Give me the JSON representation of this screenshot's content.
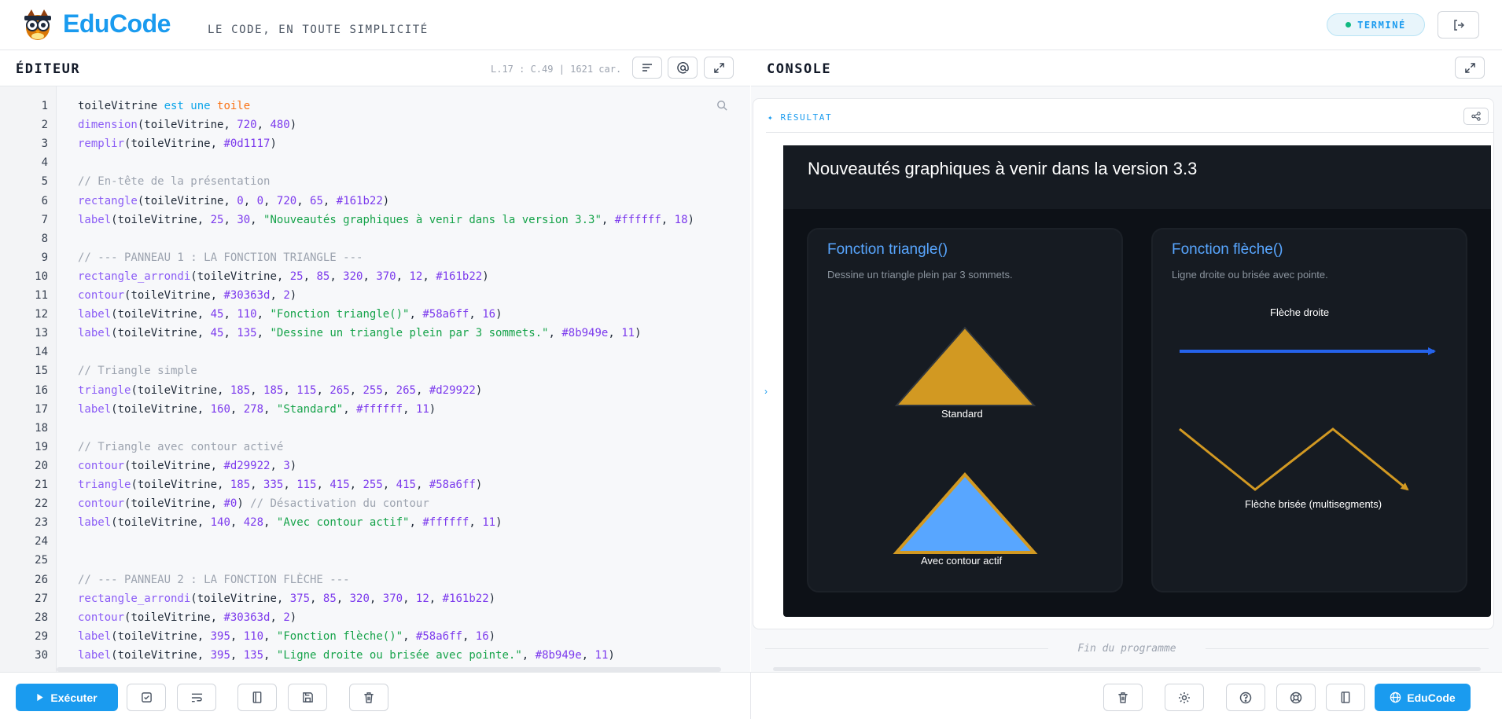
{
  "header": {
    "brand": "EduCode",
    "tagline": "LE CODE, EN TOUTE SIMPLICITÉ",
    "status": "TERMINÉ",
    "logout_icon": "logout-icon"
  },
  "editor": {
    "title": "ÉDITEUR",
    "cursor_info": "L.17 : C.49 | 1621 car.",
    "buttons": [
      "format-icon",
      "at-icon",
      "expand-icon"
    ],
    "lines": [
      {
        "n": "1",
        "tokens": [
          [
            "toileVitrine ",
            ""
          ],
          [
            "est une ",
            "kw"
          ],
          [
            "toile",
            "type"
          ]
        ]
      },
      {
        "n": "2",
        "tokens": [
          [
            "dimension",
            "fn"
          ],
          [
            "(toileVitrine, ",
            ""
          ],
          [
            "720",
            "num"
          ],
          [
            ", ",
            ""
          ],
          [
            "480",
            "num"
          ],
          [
            ")",
            ""
          ]
        ]
      },
      {
        "n": "3",
        "tokens": [
          [
            "remplir",
            "fn"
          ],
          [
            "(toileVitrine, ",
            ""
          ],
          [
            "#0d1117",
            "hex"
          ],
          [
            ")",
            ""
          ]
        ]
      },
      {
        "n": "4",
        "tokens": []
      },
      {
        "n": "5",
        "tokens": [
          [
            "// En-tête de la présentation",
            "com"
          ]
        ]
      },
      {
        "n": "6",
        "tokens": [
          [
            "rectangle",
            "fn"
          ],
          [
            "(toileVitrine, ",
            ""
          ],
          [
            "0",
            "num"
          ],
          [
            ", ",
            ""
          ],
          [
            "0",
            "num"
          ],
          [
            ", ",
            ""
          ],
          [
            "720",
            "num"
          ],
          [
            ", ",
            ""
          ],
          [
            "65",
            "num"
          ],
          [
            ", ",
            ""
          ],
          [
            "#161b22",
            "hex"
          ],
          [
            ")",
            ""
          ]
        ]
      },
      {
        "n": "7",
        "tokens": [
          [
            "label",
            "fn"
          ],
          [
            "(toileVitrine, ",
            ""
          ],
          [
            "25",
            "num"
          ],
          [
            ", ",
            ""
          ],
          [
            "30",
            "num"
          ],
          [
            ", ",
            ""
          ],
          [
            "\"Nouveautés graphiques à venir dans la version 3.3\"",
            "str"
          ],
          [
            ", ",
            ""
          ],
          [
            "#ffffff",
            "hex"
          ],
          [
            ", ",
            ""
          ],
          [
            "18",
            "num"
          ],
          [
            ")",
            ""
          ]
        ]
      },
      {
        "n": "8",
        "tokens": []
      },
      {
        "n": "9",
        "tokens": [
          [
            "// --- PANNEAU 1 : LA FONCTION TRIANGLE ---",
            "com"
          ]
        ]
      },
      {
        "n": "10",
        "tokens": [
          [
            "rectangle_arrondi",
            "fn"
          ],
          [
            "(toileVitrine, ",
            ""
          ],
          [
            "25",
            "num"
          ],
          [
            ", ",
            ""
          ],
          [
            "85",
            "num"
          ],
          [
            ", ",
            ""
          ],
          [
            "320",
            "num"
          ],
          [
            ", ",
            ""
          ],
          [
            "370",
            "num"
          ],
          [
            ", ",
            ""
          ],
          [
            "12",
            "num"
          ],
          [
            ", ",
            ""
          ],
          [
            "#161b22",
            "hex"
          ],
          [
            ")",
            ""
          ]
        ]
      },
      {
        "n": "11",
        "tokens": [
          [
            "contour",
            "fn"
          ],
          [
            "(toileVitrine, ",
            ""
          ],
          [
            "#30363d",
            "hex"
          ],
          [
            ", ",
            ""
          ],
          [
            "2",
            "num"
          ],
          [
            ")",
            ""
          ]
        ]
      },
      {
        "n": "12",
        "tokens": [
          [
            "label",
            "fn"
          ],
          [
            "(toileVitrine, ",
            ""
          ],
          [
            "45",
            "num"
          ],
          [
            ", ",
            ""
          ],
          [
            "110",
            "num"
          ],
          [
            ", ",
            ""
          ],
          [
            "\"Fonction triangle()\"",
            "str"
          ],
          [
            ", ",
            ""
          ],
          [
            "#58a6ff",
            "hex"
          ],
          [
            ", ",
            ""
          ],
          [
            "16",
            "num"
          ],
          [
            ")",
            ""
          ]
        ]
      },
      {
        "n": "13",
        "tokens": [
          [
            "label",
            "fn"
          ],
          [
            "(toileVitrine, ",
            ""
          ],
          [
            "45",
            "num"
          ],
          [
            ", ",
            ""
          ],
          [
            "135",
            "num"
          ],
          [
            ", ",
            ""
          ],
          [
            "\"Dessine un triangle plein par 3 sommets.\"",
            "str"
          ],
          [
            ", ",
            ""
          ],
          [
            "#8b949e",
            "hex"
          ],
          [
            ", ",
            ""
          ],
          [
            "11",
            "num"
          ],
          [
            ")",
            ""
          ]
        ]
      },
      {
        "n": "14",
        "tokens": []
      },
      {
        "n": "15",
        "tokens": [
          [
            "// Triangle simple",
            "com"
          ]
        ]
      },
      {
        "n": "16",
        "tokens": [
          [
            "triangle",
            "fn"
          ],
          [
            "(toileVitrine, ",
            ""
          ],
          [
            "185",
            "num"
          ],
          [
            ", ",
            ""
          ],
          [
            "185",
            "num"
          ],
          [
            ", ",
            ""
          ],
          [
            "115",
            "num"
          ],
          [
            ", ",
            ""
          ],
          [
            "265",
            "num"
          ],
          [
            ", ",
            ""
          ],
          [
            "255",
            "num"
          ],
          [
            ", ",
            ""
          ],
          [
            "265",
            "num"
          ],
          [
            ", ",
            ""
          ],
          [
            "#d29922",
            "hex"
          ],
          [
            ")",
            ""
          ]
        ]
      },
      {
        "n": "17",
        "tokens": [
          [
            "label",
            "fn"
          ],
          [
            "(toileVitrine, ",
            ""
          ],
          [
            "160",
            "num"
          ],
          [
            ", ",
            ""
          ],
          [
            "278",
            "num"
          ],
          [
            ", ",
            ""
          ],
          [
            "\"Standard\"",
            "str"
          ],
          [
            ", ",
            ""
          ],
          [
            "#ffffff",
            "hex"
          ],
          [
            ", ",
            ""
          ],
          [
            "11",
            "num"
          ],
          [
            ")",
            ""
          ]
        ]
      },
      {
        "n": "18",
        "tokens": []
      },
      {
        "n": "19",
        "tokens": [
          [
            "// Triangle avec contour activé",
            "com"
          ]
        ]
      },
      {
        "n": "20",
        "tokens": [
          [
            "contour",
            "fn"
          ],
          [
            "(toileVitrine, ",
            ""
          ],
          [
            "#d29922",
            "hex"
          ],
          [
            ", ",
            ""
          ],
          [
            "3",
            "num"
          ],
          [
            ")",
            ""
          ]
        ]
      },
      {
        "n": "21",
        "tokens": [
          [
            "triangle",
            "fn"
          ],
          [
            "(toileVitrine, ",
            ""
          ],
          [
            "185",
            "num"
          ],
          [
            ", ",
            ""
          ],
          [
            "335",
            "num"
          ],
          [
            ", ",
            ""
          ],
          [
            "115",
            "num"
          ],
          [
            ", ",
            ""
          ],
          [
            "415",
            "num"
          ],
          [
            ", ",
            ""
          ],
          [
            "255",
            "num"
          ],
          [
            ", ",
            ""
          ],
          [
            "415",
            "num"
          ],
          [
            ", ",
            ""
          ],
          [
            "#58a6ff",
            "hex"
          ],
          [
            ")",
            ""
          ]
        ]
      },
      {
        "n": "22",
        "tokens": [
          [
            "contour",
            "fn"
          ],
          [
            "(toileVitrine, ",
            ""
          ],
          [
            "#0",
            "hex"
          ],
          [
            ") ",
            ""
          ],
          [
            "// Désactivation du contour",
            "com"
          ]
        ]
      },
      {
        "n": "23",
        "tokens": [
          [
            "label",
            "fn"
          ],
          [
            "(toileVitrine, ",
            ""
          ],
          [
            "140",
            "num"
          ],
          [
            ", ",
            ""
          ],
          [
            "428",
            "num"
          ],
          [
            ", ",
            ""
          ],
          [
            "\"Avec contour actif\"",
            "str"
          ],
          [
            ", ",
            ""
          ],
          [
            "#ffffff",
            "hex"
          ],
          [
            ", ",
            ""
          ],
          [
            "11",
            "num"
          ],
          [
            ")",
            ""
          ]
        ]
      },
      {
        "n": "24",
        "tokens": []
      },
      {
        "n": "25",
        "tokens": []
      },
      {
        "n": "26",
        "tokens": [
          [
            "// --- PANNEAU 2 : LA FONCTION FLÈCHE ---",
            "com"
          ]
        ]
      },
      {
        "n": "27",
        "tokens": [
          [
            "rectangle_arrondi",
            "fn"
          ],
          [
            "(toileVitrine, ",
            ""
          ],
          [
            "375",
            "num"
          ],
          [
            ", ",
            ""
          ],
          [
            "85",
            "num"
          ],
          [
            ", ",
            ""
          ],
          [
            "320",
            "num"
          ],
          [
            ", ",
            ""
          ],
          [
            "370",
            "num"
          ],
          [
            ", ",
            ""
          ],
          [
            "12",
            "num"
          ],
          [
            ", ",
            ""
          ],
          [
            "#161b22",
            "hex"
          ],
          [
            ")",
            ""
          ]
        ]
      },
      {
        "n": "28",
        "tokens": [
          [
            "contour",
            "fn"
          ],
          [
            "(toileVitrine, ",
            ""
          ],
          [
            "#30363d",
            "hex"
          ],
          [
            ", ",
            ""
          ],
          [
            "2",
            "num"
          ],
          [
            ")",
            ""
          ]
        ]
      },
      {
        "n": "29",
        "tokens": [
          [
            "label",
            "fn"
          ],
          [
            "(toileVitrine, ",
            ""
          ],
          [
            "395",
            "num"
          ],
          [
            ", ",
            ""
          ],
          [
            "110",
            "num"
          ],
          [
            ", ",
            ""
          ],
          [
            "\"Fonction flèche()\"",
            "str"
          ],
          [
            ", ",
            ""
          ],
          [
            "#58a6ff",
            "hex"
          ],
          [
            ", ",
            ""
          ],
          [
            "16",
            "num"
          ],
          [
            ")",
            ""
          ]
        ]
      },
      {
        "n": "30",
        "tokens": [
          [
            "label",
            "fn"
          ],
          [
            "(toileVitrine, ",
            ""
          ],
          [
            "395",
            "num"
          ],
          [
            ", ",
            ""
          ],
          [
            "135",
            "num"
          ],
          [
            ", ",
            ""
          ],
          [
            "\"Ligne droite ou brisée avec pointe.\"",
            "str"
          ],
          [
            ", ",
            ""
          ],
          [
            "#8b949e",
            "hex"
          ],
          [
            ", ",
            ""
          ],
          [
            "11",
            "num"
          ],
          [
            ")",
            ""
          ]
        ]
      }
    ]
  },
  "console": {
    "title": "CONSOLE",
    "result_label": "✦ RÉSULTAT",
    "end_text": "Fin du programme",
    "canvas": {
      "background": "#0d1117",
      "header_text": "Nouveautés graphiques à venir dans la version 3.3",
      "panel1": {
        "title": "Fonction triangle()",
        "desc": "Dessine un triangle plein par 3 sommets.",
        "label_standard": "Standard",
        "label_contour": "Avec contour actif"
      },
      "panel2": {
        "title": "Fonction flèche()",
        "desc": "Ligne droite ou brisée avec pointe.",
        "label_droite": "Flèche droite",
        "label_brisee": "Flèche brisée (multisegments)"
      }
    }
  },
  "toolbar": {
    "run_label": "Exécuter",
    "educode_label": "EduCode"
  },
  "colors": {
    "accent": "#1a9bef",
    "panel_bg": "#161b22",
    "panel_border": "#30363d",
    "yellow": "#d29922",
    "blue": "#58a6ff",
    "gray": "#8b949e",
    "arrow_blue": "#2563eb"
  }
}
